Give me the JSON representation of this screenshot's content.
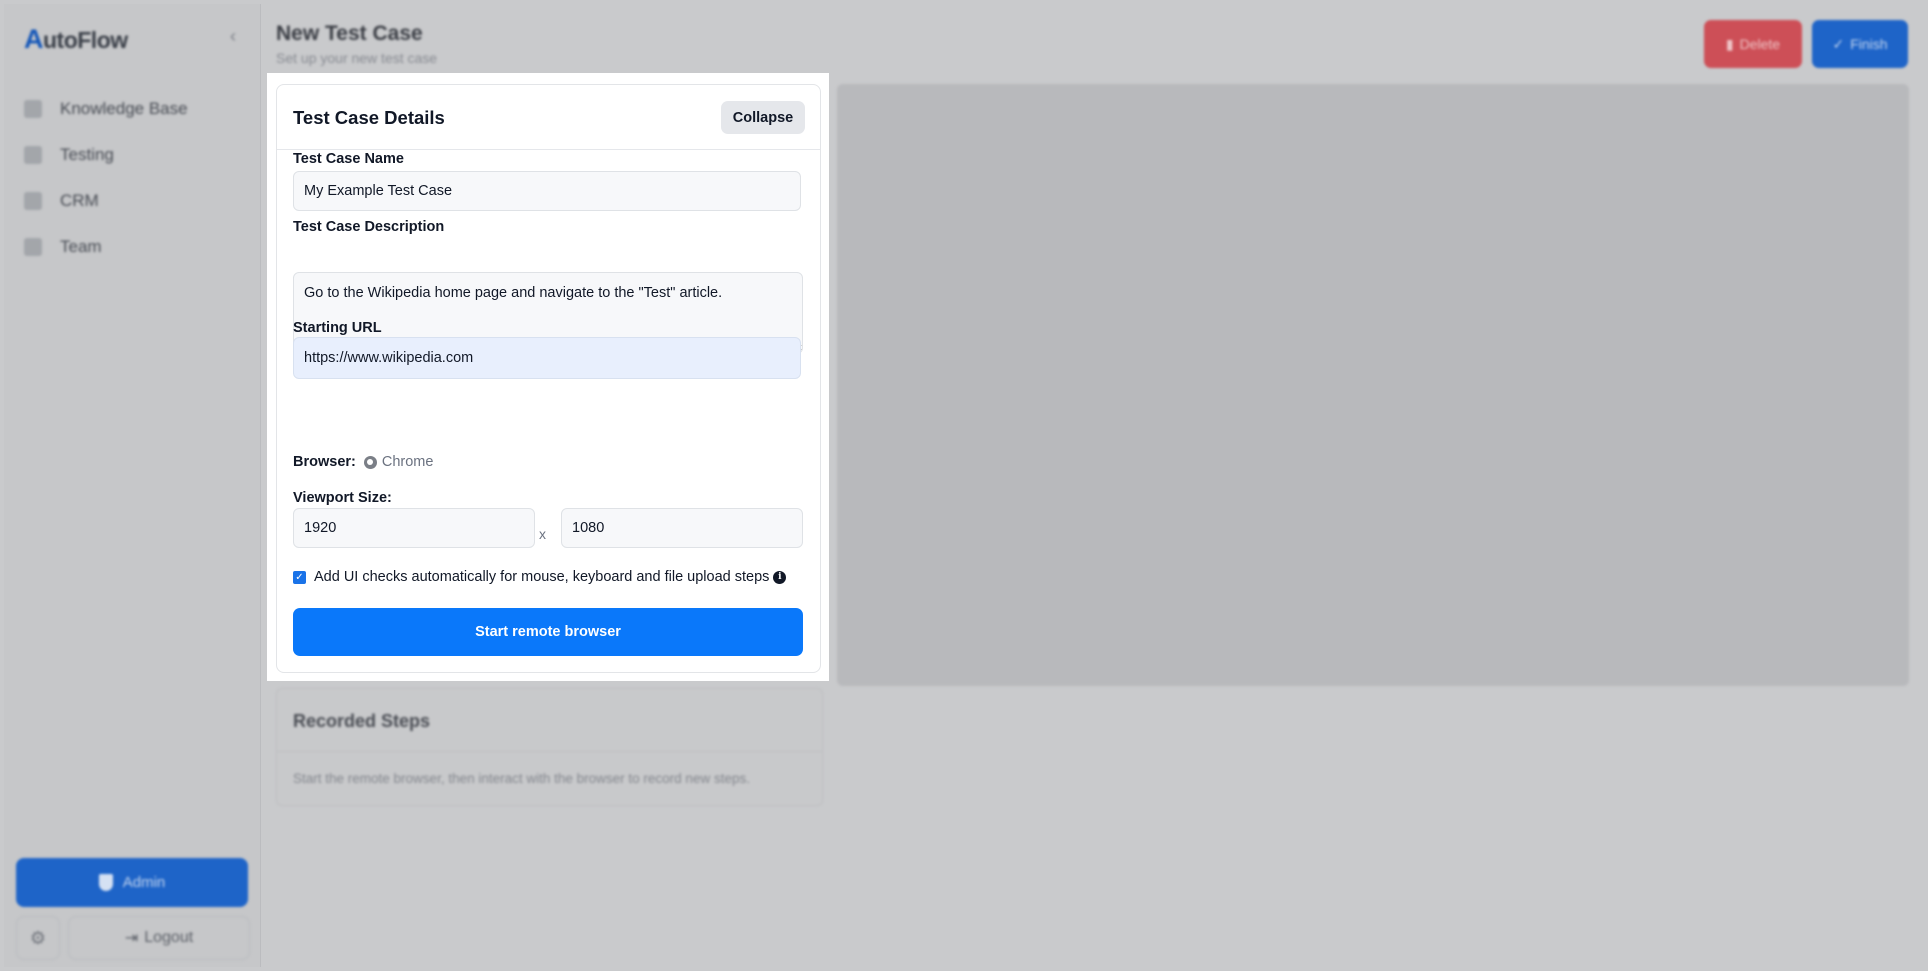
{
  "app": {
    "logo_initial": "A",
    "logo_rest": "utoFlow"
  },
  "sidebar": {
    "items": [
      {
        "label": "Knowledge Base",
        "icon": "book-icon"
      },
      {
        "label": "Testing",
        "icon": "clipboard-check-icon"
      },
      {
        "label": "CRM",
        "icon": "contact-book-icon"
      },
      {
        "label": "Team",
        "icon": "users-icon"
      }
    ],
    "admin_label": "Admin",
    "logout_label": "Logout"
  },
  "header": {
    "title": "New Test Case",
    "subtitle": "Set up your new test case",
    "delete_label": "Delete",
    "finish_label": "Finish"
  },
  "recorded_steps": {
    "title": "Recorded Steps",
    "empty_text": "Start the remote browser, then interact with the browser to record new steps."
  },
  "form": {
    "title": "Test Case Details",
    "collapse_label": "Collapse",
    "name_label": "Test Case Name",
    "name_value": "My Example Test Case",
    "description_label": "Test Case Description",
    "description_value": "Go to the Wikipedia home page and navigate to the \"Test\" article.",
    "url_label": "Starting URL",
    "url_value": "https://www.wikipedia.com",
    "browser_label": "Browser:",
    "browser_value": "Chrome",
    "viewport_label": "Viewport Size:",
    "viewport_width": "1920",
    "viewport_separator": "x",
    "viewport_height": "1080",
    "ui_checks_label": "Add UI checks automatically for mouse, keyboard and file upload steps",
    "ui_checks_checked": true,
    "start_label": "Start remote browser"
  },
  "colors": {
    "primary": "#0a78fa",
    "danger": "#dc3545",
    "overlay": "#c9cacc"
  }
}
